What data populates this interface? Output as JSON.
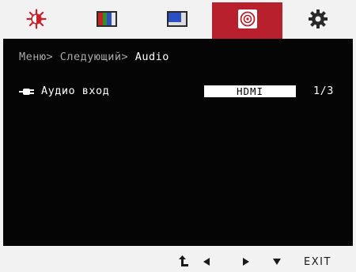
{
  "tabs": [
    {
      "icon": "brightness-icon",
      "active": false
    },
    {
      "icon": "color-bars-icon",
      "active": false
    },
    {
      "icon": "display-picture-icon",
      "active": false
    },
    {
      "icon": "audio-disc-icon",
      "active": true
    },
    {
      "icon": "gear-icon",
      "active": false
    }
  ],
  "colors": {
    "active_tab": "#b8202d",
    "panel": "#050505",
    "frame": "#f2f2f2"
  },
  "breadcrumb": {
    "item1": "Меню",
    "item2": "Следующий",
    "current": "Audio",
    "separator": ">"
  },
  "audio_input": {
    "icon": "plug-icon",
    "label": "Аудио вход",
    "value": "HDMI",
    "count": "1/3"
  },
  "hotkeys": {
    "back_icon": "return-arrow-icon",
    "left_icon": "left-triangle-icon",
    "right_icon": "right-triangle-icon",
    "down_icon": "down-triangle-icon",
    "exit_label": "EXIT"
  }
}
